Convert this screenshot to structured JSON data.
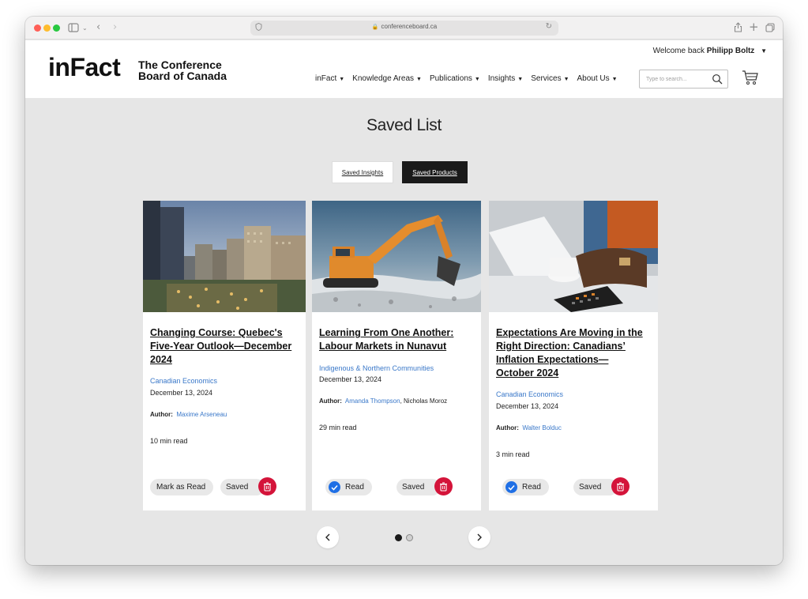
{
  "browser": {
    "url": "conferenceboard.ca"
  },
  "header": {
    "logo_infact": "inFact",
    "logo_org_line1": "The Conference",
    "logo_org_line2": "Board of Canada",
    "welcome_prefix": "Welcome back ",
    "user_name": "Philipp Boltz",
    "nav": [
      {
        "label": "inFact"
      },
      {
        "label": "Knowledge Areas"
      },
      {
        "label": "Publications"
      },
      {
        "label": "Insights"
      },
      {
        "label": "Services"
      },
      {
        "label": "About Us"
      }
    ],
    "search_placeholder": "Type to search..."
  },
  "main": {
    "title": "Saved List",
    "tabs": {
      "insights": "Saved Insights",
      "products": "Saved Products",
      "active": "products"
    },
    "cards": [
      {
        "title": "Changing Course: Quebec's Five-Year Outlook—December 2024",
        "category": "Canadian Economics",
        "date": "December 13, 2024",
        "author_label": "Author:",
        "author_link": "Maxime Arseneau",
        "author_rest": "",
        "read_time": "10 min read",
        "read_button": "Mark as Read",
        "read_state": false,
        "saved_button": "Saved"
      },
      {
        "title": "Learning From One Another: Labour Markets in Nunavut",
        "category": "Indigenous & Northern Communities",
        "date": "December 13, 2024",
        "author_label": "Author:",
        "author_link": "Amanda Thompson",
        "author_rest": ", Nicholas Moroz",
        "read_time": "29 min read",
        "read_button": "Read",
        "read_state": true,
        "saved_button": "Saved"
      },
      {
        "title": "Expectations Are Moving in the Right Direction: Canadians’ Inflation Expectations—October 2024",
        "category": "Canadian Economics",
        "date": "December 13, 2024",
        "author_label": "Author:",
        "author_link": "Walter Bolduc",
        "author_rest": "",
        "read_time": "3 min read",
        "read_button": "Read",
        "read_state": true,
        "saved_button": "Saved"
      }
    ],
    "pagination": {
      "current_page": 1,
      "total_pages": 2
    }
  },
  "colors": {
    "accent_link": "#3a78c9",
    "trash_red": "#d4143a",
    "check_blue": "#1f6fe5",
    "page_bg": "#e6e6e6"
  }
}
